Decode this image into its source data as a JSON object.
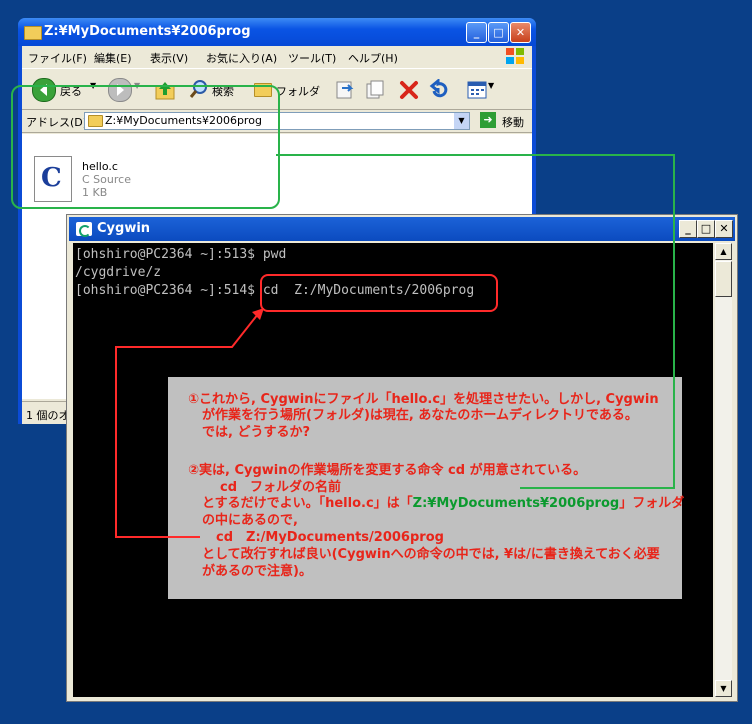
{
  "explorer": {
    "title": "Z:¥MyDocuments¥2006prog",
    "menu": [
      "ファイル(F)",
      "編集(E)",
      "表示(V)",
      "お気に入り(A)",
      "ツール(T)",
      "ヘルプ(H)"
    ],
    "toolbar": {
      "back_label": "戻る",
      "search_label": "検索",
      "folders_label": "フォルダ"
    },
    "address": {
      "label": "アドレス(D)",
      "value": "Z:¥MyDocuments¥2006prog",
      "go_label": "移動"
    },
    "file": {
      "name": "hello.c",
      "type": "C Source",
      "size": "1 KB"
    },
    "status": "1 個のオ"
  },
  "cygwin": {
    "title": "Cygwin",
    "lines": [
      "[ohshiro@PC2364 ~]:513$ pwd",
      "/cygdrive/z",
      "[ohshiro@PC2364 ~]:514$ cd  Z:/MyDocuments/2006prog"
    ]
  },
  "note": {
    "l1": "①これから, Cygwinにファイル「hello.c」を処理させたい。しかし, Cygwin",
    "l2": "が作業を行う場所(フォルダ)は現在, あなたのホームディレクトリである。",
    "l3": "では, どうするか?",
    "l4": "②実は, Cygwinの作業場所を変更する命令 cd が用意されている。",
    "l5": "cd　フォルダの名前",
    "l6a": "とするだけでよい。「hello.c」は「",
    "l6b": "Z:¥MyDocuments¥2006prog",
    "l6c": "」フォルダ",
    "l7": "の中にあるので,",
    "l8": "cd　Z:/MyDocuments/2006prog",
    "l9": "として改行すれば良い(Cygwinへの命令の中では, ¥は/に書き換えておく必要",
    "l10": "があるので注意)。"
  },
  "colors": {
    "desktop": "#0a3f88",
    "red_annotation": "#ff2a2a",
    "green_annotation": "#29b34a"
  }
}
